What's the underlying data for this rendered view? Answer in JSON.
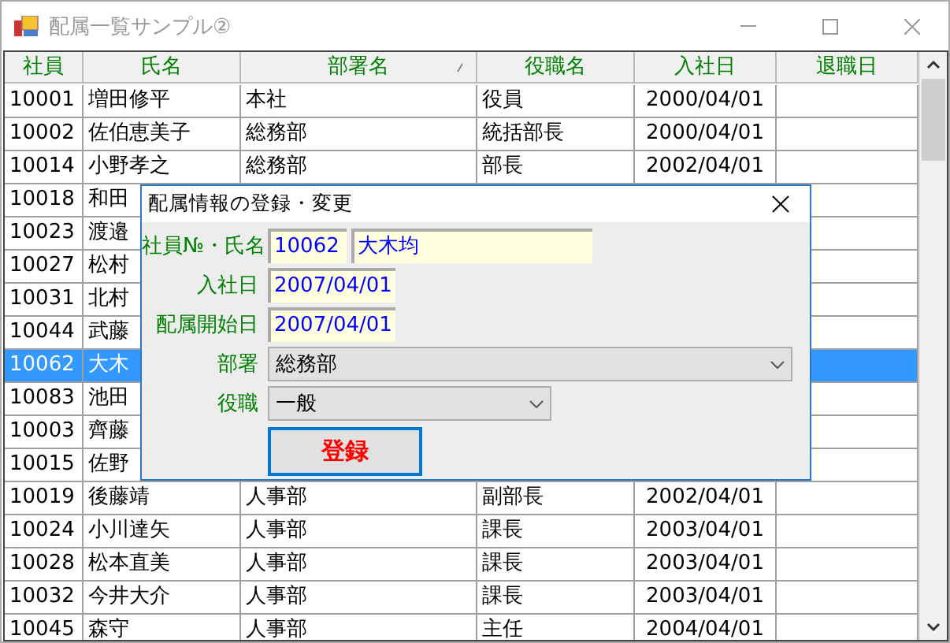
{
  "window": {
    "title": "配属一覧サンプル②"
  },
  "grid": {
    "columns": [
      {
        "label": "社員",
        "sorted": false
      },
      {
        "label": "氏名",
        "sorted": false
      },
      {
        "label": "部署名",
        "sorted": true
      },
      {
        "label": "役職名",
        "sorted": false
      },
      {
        "label": "入社日",
        "sorted": false
      },
      {
        "label": "退職日",
        "sorted": false
      }
    ],
    "rows": [
      {
        "id": "10001",
        "name": "増田修平",
        "department": "本社",
        "position": "役員",
        "joined": "2000/04/01",
        "selected": false
      },
      {
        "id": "10002",
        "name": "佐伯恵美子",
        "department": "総務部",
        "position": "統括部長",
        "joined": "2000/04/01",
        "selected": false
      },
      {
        "id": "10014",
        "name": "小野孝之",
        "department": "総務部",
        "position": "部長",
        "joined": "2002/04/01",
        "selected": false
      },
      {
        "id": "10018",
        "name": "和田",
        "selected": false
      },
      {
        "id": "10023",
        "name": "渡邉",
        "selected": false
      },
      {
        "id": "10027",
        "name": "松村",
        "selected": false
      },
      {
        "id": "10031",
        "name": "北村",
        "selected": false
      },
      {
        "id": "10044",
        "name": "武藤",
        "selected": false
      },
      {
        "id": "10062",
        "name": "大木",
        "selected": true
      },
      {
        "id": "10083",
        "name": "池田",
        "selected": false
      },
      {
        "id": "10003",
        "name": "齊藤",
        "selected": false
      },
      {
        "id": "10015",
        "name": "佐野",
        "selected": false
      },
      {
        "id": "10019",
        "name": "後藤靖",
        "department": "人事部",
        "position": "副部長",
        "joined": "2002/04/01",
        "selected": false
      },
      {
        "id": "10024",
        "name": "小川達矢",
        "department": "人事部",
        "position": "課長",
        "joined": "2003/04/01",
        "selected": false
      },
      {
        "id": "10028",
        "name": "松本直美",
        "department": "人事部",
        "position": "課長",
        "joined": "2003/04/01",
        "selected": false
      },
      {
        "id": "10032",
        "name": "今井大介",
        "department": "人事部",
        "position": "課長",
        "joined": "2003/04/01",
        "selected": false
      },
      {
        "id": "10045",
        "name": "森守",
        "department": "人事部",
        "position": "主任",
        "joined": "2004/04/01",
        "selected": false
      }
    ]
  },
  "dialog": {
    "title": "配属情報の登録・変更",
    "fields": [
      {
        "kind": "pair",
        "label": "社員№・氏名",
        "values": [
          "10062",
          "大木均"
        ]
      },
      {
        "kind": "text",
        "label": "入社日",
        "value": "2007/04/01"
      },
      {
        "kind": "text",
        "label": "配属開始日",
        "value": "2007/04/01"
      },
      {
        "kind": "select",
        "label": "部署",
        "value": "総務部"
      },
      {
        "kind": "select",
        "label": "役職",
        "value": "一般"
      }
    ],
    "button": {
      "label": "登録"
    }
  }
}
